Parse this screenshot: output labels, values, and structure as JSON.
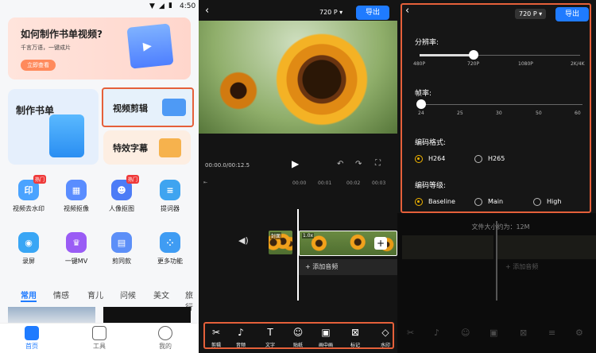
{
  "phone1": {
    "status_time": "4:50",
    "banner": {
      "title": "如何制作书单视频?",
      "subtitle": "千言万语，一键成片",
      "cta": "立即查看"
    },
    "card_booklist": "制作书单",
    "card_video_edit": "视频剪辑",
    "card_subtitle": "特效字幕",
    "features": [
      {
        "label": "视频去水印",
        "hot": "热门",
        "color": "#4aa3ff"
      },
      {
        "label": "视频抠像",
        "hot": "",
        "color": "#5a8dff"
      },
      {
        "label": "人像抠图",
        "hot": "热门",
        "color": "#4d7cf6"
      },
      {
        "label": "提词器",
        "hot": "",
        "color": "#3fa4f0"
      },
      {
        "label": "录屏",
        "hot": "",
        "color": "#39a6f5"
      },
      {
        "label": "一键MV",
        "hot": "",
        "color": "#9a5cf5"
      },
      {
        "label": "剪同款",
        "hot": "",
        "color": "#5c8ff8"
      },
      {
        "label": "更多功能",
        "hot": "",
        "color": "#3f9cf3"
      }
    ],
    "tabs": [
      "常用",
      "情感",
      "育儿",
      "问候",
      "美文",
      "旅行"
    ],
    "active_tab": "常用",
    "nav": [
      "首页",
      "工具",
      "我的"
    ]
  },
  "phone2": {
    "resolution": "720 P",
    "export": "导出",
    "time": "00:00.0/00:12.5",
    "ruler": [
      "00:00",
      "00:01",
      "00:02",
      "00:03"
    ],
    "cover": "封面",
    "speed": "1.0x",
    "add_audio": "+ 添加音频",
    "tools": [
      {
        "icon": "✂",
        "label": "剪辑",
        "name": "cut-icon"
      },
      {
        "icon": "♪",
        "label": "音频",
        "name": "audio-icon"
      },
      {
        "icon": "T",
        "label": "文字",
        "name": "text-icon"
      },
      {
        "icon": "☺",
        "label": "贴纸",
        "name": "sticker-icon"
      },
      {
        "icon": "▣",
        "label": "画中画",
        "name": "picture-in-picture-icon"
      },
      {
        "icon": "⊠",
        "label": "标记",
        "name": "mark-icon"
      },
      {
        "icon": "◇",
        "label": "水印",
        "name": "watermark-icon"
      }
    ]
  },
  "phone3": {
    "resolution": "720 P",
    "export": "导出",
    "res_label": "分辨率:",
    "res_ticks": [
      "480P",
      "720P",
      "1080P",
      "2K/4K"
    ],
    "res_value": "720P",
    "fps_label": "帧率:",
    "fps_ticks": [
      "24",
      "25",
      "30",
      "50",
      "60"
    ],
    "fps_value": "24",
    "codec_label": "编码格式:",
    "codec_options": [
      "H264",
      "H265"
    ],
    "codec_selected": "H264",
    "level_label": "编码等级:",
    "level_options": [
      "Baseline",
      "Main",
      "High"
    ],
    "level_selected": "Baseline",
    "file_size": "文件大小约为：12M",
    "add_audio": "+ 添加音频"
  },
  "colors": {
    "accent": "#1f7bff",
    "highlight_box": "#e5603a",
    "radio_selected": "#f2b400"
  }
}
